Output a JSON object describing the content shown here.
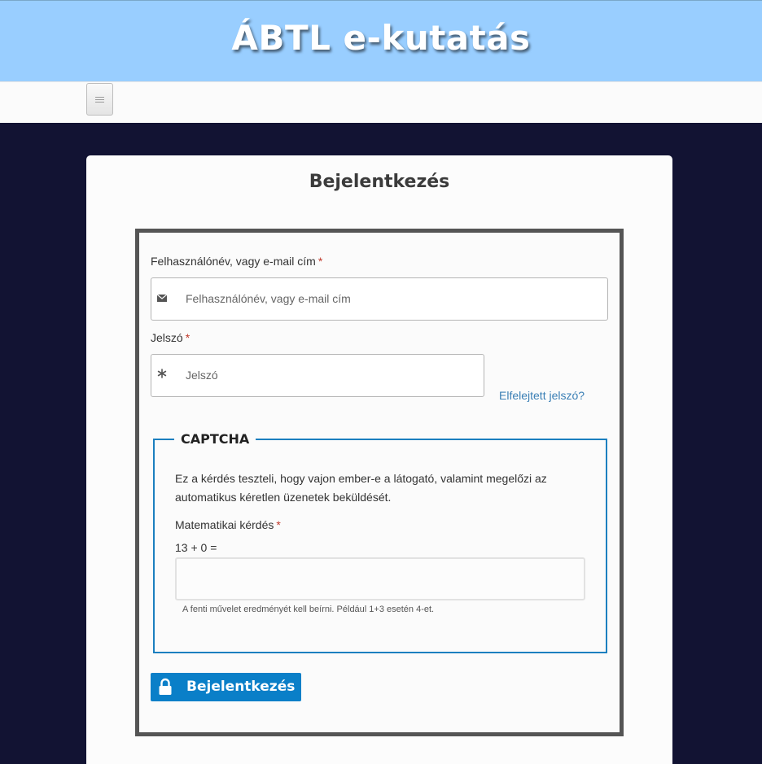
{
  "header": {
    "site_title": "ÁBTL e-kutatás"
  },
  "navbar": {
    "menu_icon": "hamburger-icon"
  },
  "page": {
    "title": "Bejelentkezés"
  },
  "login_form": {
    "username_label": "Felhasználónév, vagy e-mail cím",
    "username_placeholder": "Felhasználónév, vagy e-mail cím",
    "username_icon": "envelope-icon",
    "password_label": "Jelszó",
    "password_placeholder": "Jelszó",
    "password_icon": "asterisk-icon",
    "required_mark": "*",
    "forgot_password": "Elfelejtett jelszó?"
  },
  "captcha": {
    "legend": "CAPTCHA",
    "description": "Ez a kérdés teszteli, hogy vajon ember-e a látogató, valamint megelőzi az automatikus kéretlen üzenetek beküldését.",
    "question_label": "Matematikai kérdés",
    "question": "13 + 0 =",
    "answer_value": "",
    "hint": "A fenti művelet eredményét kell beírni. Például 1+3 esetén 4-et."
  },
  "submit": {
    "label": "Bejelentkezés",
    "icon": "lock-icon"
  },
  "colors": {
    "header_bg": "#99ceff",
    "page_bg": "#121333",
    "accent_blue": "#0a7fc8",
    "required_red": "#c0392b"
  }
}
